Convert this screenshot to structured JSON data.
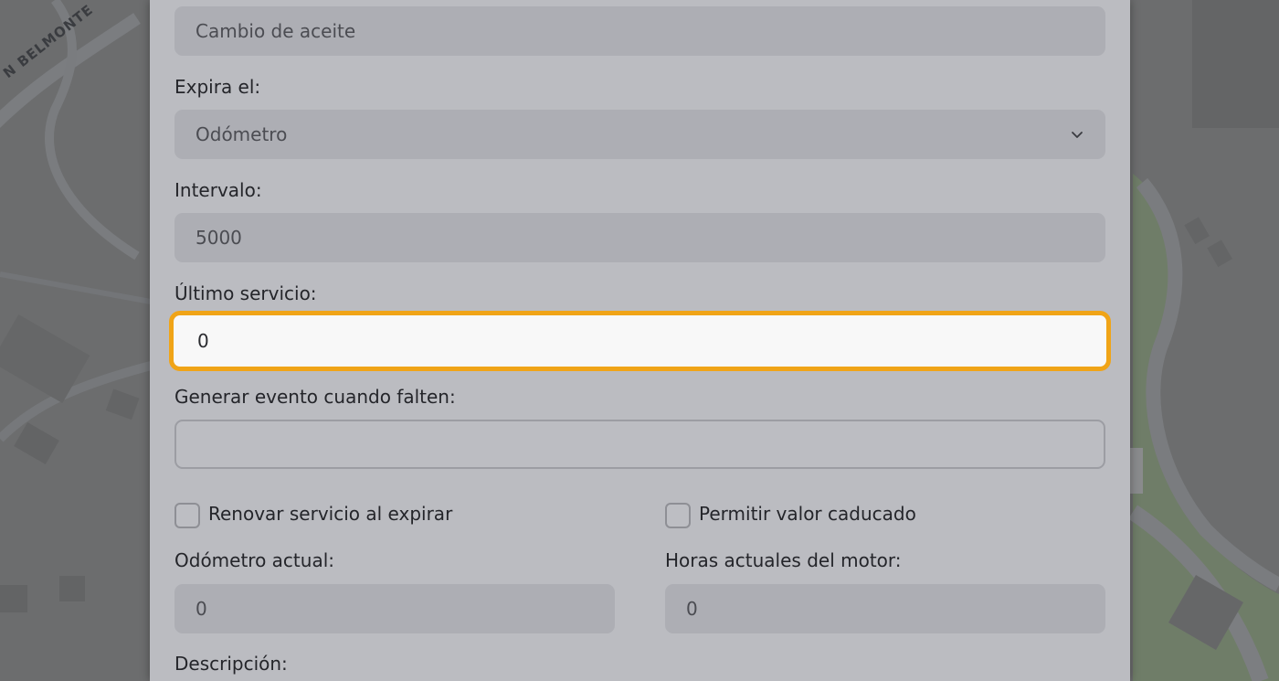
{
  "form": {
    "name_value": "Cambio de aceite",
    "expires_label": "Expira el:",
    "expires_value": "Odómetro",
    "interval_label": "Intervalo:",
    "interval_value": "5000",
    "last_service_label": "Último servicio:",
    "last_service_value": "0",
    "event_label": "Generar evento cuando falten:",
    "event_value": "",
    "renew_label": "Renovar servicio al expirar",
    "renew_checked": false,
    "allow_expired_label": "Permitir valor caducado",
    "allow_expired_checked": false,
    "odometer_label": "Odómetro actual:",
    "odometer_value": "0",
    "engine_hours_label": "Horas actuales del motor:",
    "engine_hours_value": "0",
    "description_label": "Descripción:"
  },
  "map": {
    "street_label": "N BELMONTE"
  },
  "colors": {
    "focus_outline": "#f0a417",
    "modal_background": "#bbbcc1",
    "input_background": "#adaeb4"
  },
  "icons": {
    "select_chevron": "chevron-down-icon"
  }
}
